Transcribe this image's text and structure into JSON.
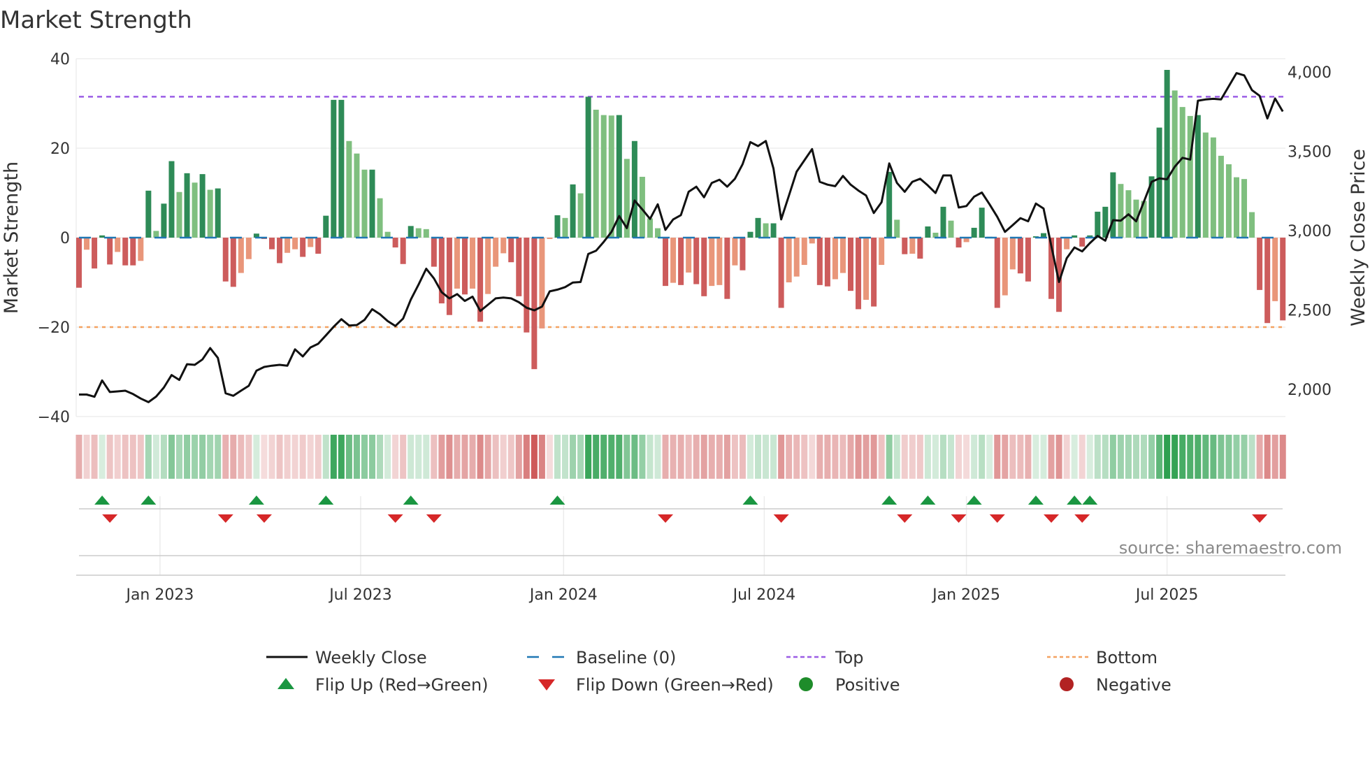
{
  "title": "Market Strength",
  "source": "source: sharemaestro.com",
  "colors": {
    "strong_green": "#2e8b57",
    "weak_green": "#7fbf7f",
    "strong_red": "#cd5c5c",
    "weak_red": "#e9967a",
    "baseline": "#1f77b4",
    "top": "#9b5de5",
    "bottom": "#f4a261",
    "flip_up": "#1a9641",
    "flip_down": "#d62728",
    "positive": "#1e8c2a",
    "negative": "#b22222",
    "close": "#111111"
  },
  "legend": [
    {
      "label": "Weekly Close"
    },
    {
      "label": "Baseline (0)"
    },
    {
      "label": "Top"
    },
    {
      "label": "Bottom"
    },
    {
      "label": "Flip Up (Red→Green)"
    },
    {
      "label": "Flip Down (Green→Red)"
    },
    {
      "label": "Positive"
    },
    {
      "label": "Negative"
    }
  ],
  "chart_data": {
    "type": "bar",
    "title": "Market Strength",
    "ylabel": "Market Strength",
    "y2label": "Weekly Close Price",
    "ylim": [
      -40,
      40
    ],
    "y2lim": [
      1750,
      4000
    ],
    "yticks": [
      "40",
      "20",
      "0",
      "−20",
      "−40"
    ],
    "y2ticks": [
      "4,000",
      "3,500",
      "3,000",
      "2,500",
      "2,000"
    ],
    "xticks": [
      "Jan 2023",
      "Jul 2023",
      "Jan 2024",
      "Jul 2024",
      "Jan 2025",
      "Jul 2025"
    ],
    "xtick_week_index": [
      11.5,
      37.5,
      63.8,
      89.8,
      116,
      142
    ],
    "reference_lines": {
      "top": 31.5,
      "baseline": 0,
      "bottom": -20
    },
    "strength": [
      -11.2,
      -2.7,
      -6.9,
      0.5,
      -6.0,
      -3.2,
      -6.2,
      -6.2,
      -5.2,
      10.5,
      1.5,
      7.6,
      17.1,
      10.2,
      14.4,
      12.3,
      14.2,
      10.7,
      11.0,
      -9.8,
      -11.0,
      -7.9,
      -4.8,
      0.9,
      -0.3,
      -2.6,
      -5.7,
      -3.4,
      -2.6,
      -4.3,
      -2.1,
      -3.6,
      4.9,
      30.8,
      30.8,
      21.6,
      18.8,
      15.2,
      15.2,
      8.8,
      1.3,
      -2.2,
      -5.9,
      2.6,
      2.1,
      1.9,
      -6.5,
      -14.7,
      -17.3,
      -11.4,
      -12.7,
      -11.4,
      -18.8,
      -12.6,
      -6.5,
      -3.5,
      -5.5,
      -13.1,
      -21.2,
      -29.4,
      -20.3,
      -0.3,
      5.0,
      4.4,
      11.9,
      9.9,
      31.5,
      28.6,
      27.4,
      27.3,
      27.4,
      17.6,
      21.6,
      13.6,
      4.3,
      2.1,
      -10.8,
      -10.1,
      -10.6,
      -7.8,
      -10.4,
      -13.1,
      -10.8,
      -10.6,
      -13.7,
      -6.2,
      -7.3,
      1.3,
      4.4,
      3.2,
      3.2,
      -15.7,
      -10.0,
      -8.7,
      -6.1,
      -1.3,
      -10.6,
      -10.9,
      -9.3,
      -7.9,
      -11.9,
      -16.0,
      -13.9,
      -15.4,
      -6.1,
      14.7,
      4.0,
      -3.7,
      -3.6,
      -4.7,
      2.5,
      1.1,
      6.9,
      3.8,
      -2.2,
      -1.0,
      2.2,
      6.7,
      0.2,
      -15.7,
      -12.9,
      -7.1,
      -8.0,
      -9.8,
      0.3,
      1.0,
      -13.7,
      -16.6,
      -2.6,
      0.5,
      -2.0,
      0.5,
      5.8,
      6.9,
      14.6,
      12.0,
      10.6,
      8.5,
      8.2,
      13.7,
      24.6,
      37.5,
      32.9,
      29.2,
      27.2,
      27.4,
      23.5,
      22.4,
      18.3,
      16.4,
      13.5,
      13.1,
      5.7,
      -11.7,
      -19.1,
      -14.2,
      -18.5
    ],
    "weekly_close": [
      1967,
      1967,
      1953,
      2056,
      1983,
      1987,
      1991,
      1970,
      1942,
      1919,
      1954,
      2011,
      2090,
      2059,
      2158,
      2154,
      2188,
      2260,
      2198,
      1975,
      1959,
      1991,
      2022,
      2117,
      2141,
      2149,
      2154,
      2149,
      2252,
      2207,
      2264,
      2287,
      2340,
      2394,
      2442,
      2402,
      2405,
      2438,
      2505,
      2473,
      2430,
      2399,
      2446,
      2565,
      2660,
      2760,
      2699,
      2612,
      2573,
      2600,
      2557,
      2584,
      2494,
      2533,
      2573,
      2578,
      2573,
      2549,
      2514,
      2498,
      2521,
      2617,
      2628,
      2644,
      2673,
      2676,
      2853,
      2873,
      2929,
      2992,
      3092,
      3016,
      3190,
      3134,
      3074,
      3166,
      3005,
      3071,
      3098,
      3245,
      3277,
      3210,
      3301,
      3321,
      3277,
      3327,
      3419,
      3558,
      3533,
      3565,
      3391,
      3071,
      3221,
      3372,
      3443,
      3514,
      3308,
      3290,
      3280,
      3345,
      3290,
      3253,
      3221,
      3111,
      3179,
      3424,
      3301,
      3245,
      3308,
      3327,
      3285,
      3237,
      3348,
      3348,
      3146,
      3155,
      3214,
      3240,
      3166,
      3087,
      2992,
      3035,
      3079,
      3059,
      3171,
      3139,
      2905,
      2676,
      2826,
      2894,
      2869,
      2921,
      2967,
      2937,
      3066,
      3063,
      3103,
      3059,
      3182,
      3308,
      3329,
      3324,
      3403,
      3459,
      3448,
      3819,
      3827,
      3831,
      3827,
      3910,
      3993,
      3979,
      3886,
      3850,
      3707,
      3833,
      3751
    ],
    "flip_up_weeks": [
      4,
      10,
      24,
      33,
      44,
      63,
      88,
      106,
      111,
      117,
      125,
      130,
      132
    ],
    "flip_down_weeks": [
      5,
      20,
      25,
      42,
      47,
      77,
      92,
      108,
      115,
      120,
      127,
      131,
      154
    ],
    "legend_position": "bottom"
  }
}
